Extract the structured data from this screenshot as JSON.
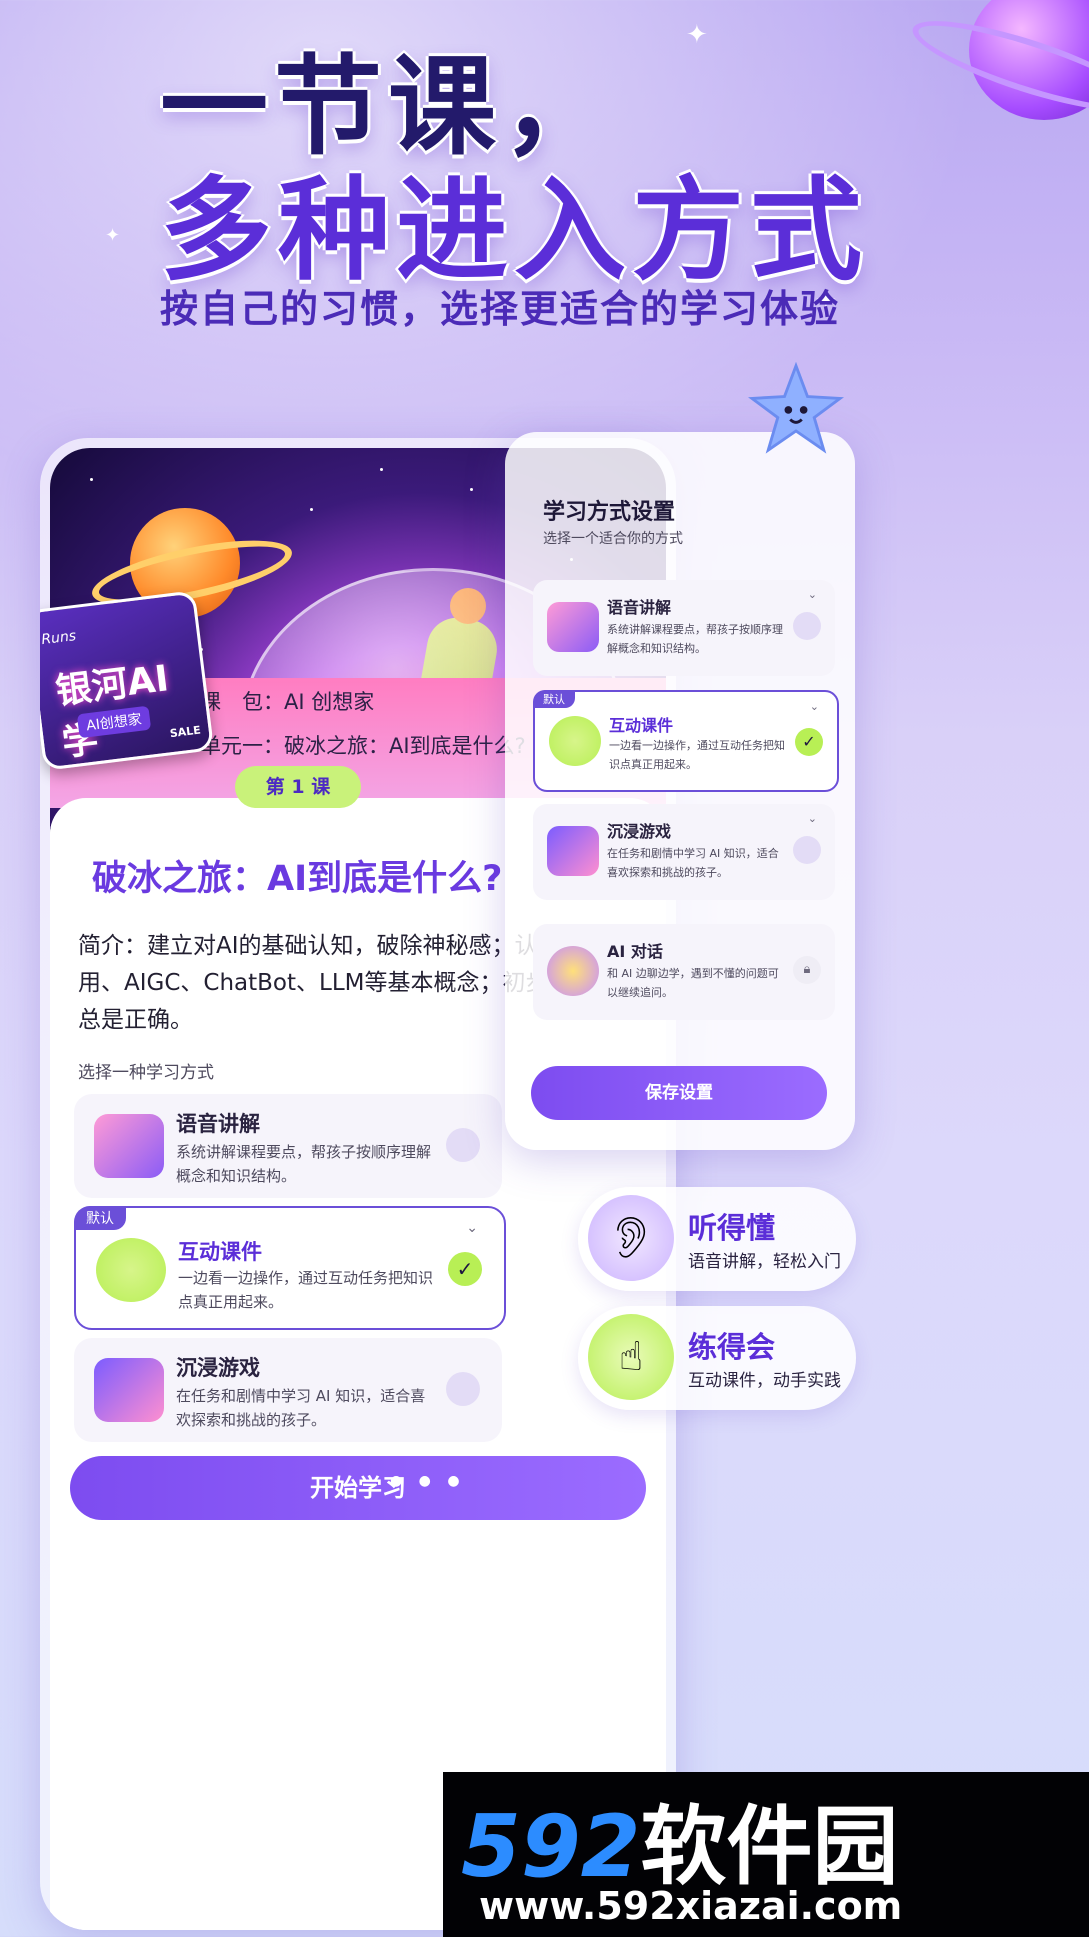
{
  "headline": {
    "line1": "一节课，",
    "line2": "多种进入方式",
    "subtitle": "按自己的习惯，选择更适合的学习体验"
  },
  "course": {
    "book_cover": {
      "runs": "Runs",
      "title": "银河AI学",
      "sub": "AI创想家",
      "sale": "SALE"
    },
    "package_label": "课　包：AI 创想家",
    "unit_label": "单元一：破冰之旅：AI到底是什么?",
    "lesson_badge": "第 1 课",
    "lesson_title": "破冰之旅：AI到底是什么?",
    "lesson_description": "简介：建立对AI的基础认知，破除神秘感；认识AI、AI应用、AIGC、ChatBot、LLM等基本概念；初步理解AI并不总是正确。",
    "choose_label": "选择一种学习方式",
    "options": [
      {
        "title": "语音讲解",
        "desc": "系统讲解课程要点，帮孩子按顺序理解概念和知识结构。",
        "selected": false
      },
      {
        "title": "互动课件",
        "desc": "一边看一边操作，通过互动任务把知识点真正用起来。",
        "selected": true,
        "badge": "默认"
      },
      {
        "title": "沉浸游戏",
        "desc": "在任务和剧情中学习 AI 知识，适合喜欢探索和挑战的孩子。",
        "selected": false
      }
    ],
    "start_button": "开始学习",
    "check_mark": "✓",
    "chevron": "⌄"
  },
  "settings": {
    "title": "学习方式设置",
    "subtitle": "选择一个适合你的方式",
    "options": [
      {
        "title": "语音讲解",
        "desc": "系统讲解课程要点，帮孩子按顺序理解概念和知识结构。",
        "state": "unchecked"
      },
      {
        "title": "互动课件",
        "desc": "一边看一边操作，通过互动任务把知识点真正用起来。",
        "state": "checked",
        "badge": "默认"
      },
      {
        "title": "沉浸游戏",
        "desc": "在任务和剧情中学习 AI 知识，适合喜欢探索和挑战的孩子。",
        "state": "unchecked"
      },
      {
        "title": "AI 对话",
        "desc": "和 AI 边聊边学，遇到不懂的问题可以继续追问。",
        "state": "locked"
      }
    ],
    "save_button": "保存设置",
    "lock_icon": "lock-icon"
  },
  "features": [
    {
      "title": "听得懂",
      "sub": "语音讲解，轻松入门",
      "icon": "ear-icon"
    },
    {
      "title": "练得会",
      "sub": "互动课件，动手实践",
      "icon": "tap-hand-icon"
    }
  ],
  "watermark": {
    "logo_number": "592",
    "logo_text": "软件园",
    "url": "www.592xiazai.com"
  },
  "colors": {
    "accent": "#6b4fd8",
    "highlight_green": "#b8ef55",
    "title_purple": "#5b2ed8"
  }
}
